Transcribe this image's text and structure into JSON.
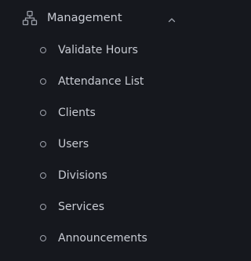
{
  "sidebar": {
    "group": {
      "label": "Management",
      "icon": "hierarchy-icon",
      "expanded": true,
      "toggle_icon": "chevron-up-icon"
    },
    "items": [
      {
        "label": "Validate Hours",
        "icon": "circle-bullet-icon"
      },
      {
        "label": "Attendance List",
        "icon": "circle-bullet-icon"
      },
      {
        "label": "Clients",
        "icon": "circle-bullet-icon"
      },
      {
        "label": "Users",
        "icon": "circle-bullet-icon"
      },
      {
        "label": "Divisions",
        "icon": "circle-bullet-icon"
      },
      {
        "label": "Services",
        "icon": "circle-bullet-icon"
      },
      {
        "label": "Announcements",
        "icon": "circle-bullet-icon"
      }
    ]
  },
  "colors": {
    "background": "#16181e",
    "text": "#c9ccd4",
    "icon": "#9ea2ac"
  }
}
